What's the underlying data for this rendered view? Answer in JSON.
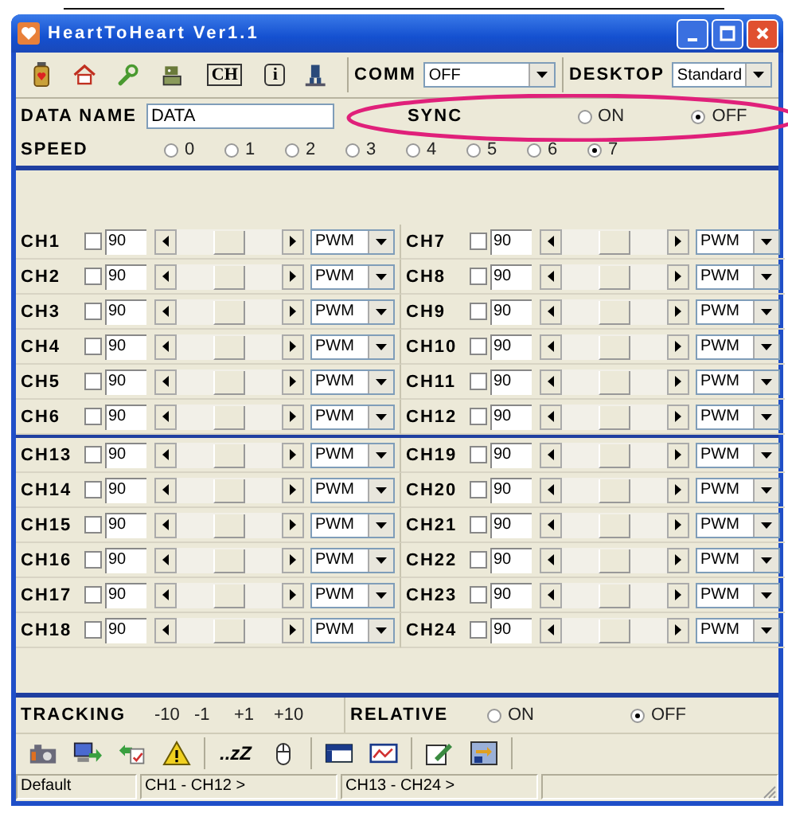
{
  "window": {
    "title": "HeartToHeart Ver1.1"
  },
  "toolbar": {
    "ch_button": "CH",
    "info_button": "i",
    "comm": {
      "label": "COMM",
      "value": "OFF"
    },
    "desktop": {
      "label": "DESKTOP",
      "value": "Standard"
    }
  },
  "data_name": {
    "label": "DATA NAME",
    "value": "DATA"
  },
  "sync": {
    "label": "SYNC",
    "options": [
      {
        "label": "ON",
        "selected": false
      },
      {
        "label": "OFF",
        "selected": true
      }
    ]
  },
  "speed": {
    "label": "SPEED",
    "options": [
      {
        "label": "0",
        "selected": false
      },
      {
        "label": "1",
        "selected": false
      },
      {
        "label": "2",
        "selected": false
      },
      {
        "label": "3",
        "selected": false
      },
      {
        "label": "4",
        "selected": false
      },
      {
        "label": "5",
        "selected": false
      },
      {
        "label": "6",
        "selected": false
      },
      {
        "label": "7",
        "selected": true
      }
    ]
  },
  "channel_groups": [
    {
      "channels": [
        {
          "name": "CH1",
          "checked": false,
          "value": "90",
          "mode": "PWM"
        },
        {
          "name": "CH2",
          "checked": false,
          "value": "90",
          "mode": "PWM"
        },
        {
          "name": "CH3",
          "checked": false,
          "value": "90",
          "mode": "PWM"
        },
        {
          "name": "CH4",
          "checked": false,
          "value": "90",
          "mode": "PWM"
        },
        {
          "name": "CH5",
          "checked": false,
          "value": "90",
          "mode": "PWM"
        },
        {
          "name": "CH6",
          "checked": false,
          "value": "90",
          "mode": "PWM"
        },
        {
          "name": "CH7",
          "checked": false,
          "value": "90",
          "mode": "PWM"
        },
        {
          "name": "CH8",
          "checked": false,
          "value": "90",
          "mode": "PWM"
        },
        {
          "name": "CH9",
          "checked": false,
          "value": "90",
          "mode": "PWM"
        },
        {
          "name": "CH10",
          "checked": false,
          "value": "90",
          "mode": "PWM"
        },
        {
          "name": "CH11",
          "checked": false,
          "value": "90",
          "mode": "PWM"
        },
        {
          "name": "CH12",
          "checked": false,
          "value": "90",
          "mode": "PWM"
        }
      ]
    },
    {
      "channels": [
        {
          "name": "CH13",
          "checked": false,
          "value": "90",
          "mode": "PWM"
        },
        {
          "name": "CH14",
          "checked": false,
          "value": "90",
          "mode": "PWM"
        },
        {
          "name": "CH15",
          "checked": false,
          "value": "90",
          "mode": "PWM"
        },
        {
          "name": "CH16",
          "checked": false,
          "value": "90",
          "mode": "PWM"
        },
        {
          "name": "CH17",
          "checked": false,
          "value": "90",
          "mode": "PWM"
        },
        {
          "name": "CH18",
          "checked": false,
          "value": "90",
          "mode": "PWM"
        },
        {
          "name": "CH19",
          "checked": false,
          "value": "90",
          "mode": "PWM"
        },
        {
          "name": "CH20",
          "checked": false,
          "value": "90",
          "mode": "PWM"
        },
        {
          "name": "CH21",
          "checked": false,
          "value": "90",
          "mode": "PWM"
        },
        {
          "name": "CH22",
          "checked": false,
          "value": "90",
          "mode": "PWM"
        },
        {
          "name": "CH23",
          "checked": false,
          "value": "90",
          "mode": "PWM"
        },
        {
          "name": "CH24",
          "checked": false,
          "value": "90",
          "mode": "PWM"
        }
      ]
    }
  ],
  "tracking": {
    "label": "TRACKING",
    "buttons": [
      "-10",
      "-1",
      "+1",
      "+10"
    ]
  },
  "relative": {
    "label": "RELATIVE",
    "options": [
      {
        "label": "ON",
        "selected": false
      },
      {
        "label": "OFF",
        "selected": true
      }
    ]
  },
  "bottom_toolbar": {
    "sleep_button": "..zZ"
  },
  "status_bar": [
    "Default",
    "CH1 - CH12 >",
    "CH13 - CH24 >"
  ]
}
